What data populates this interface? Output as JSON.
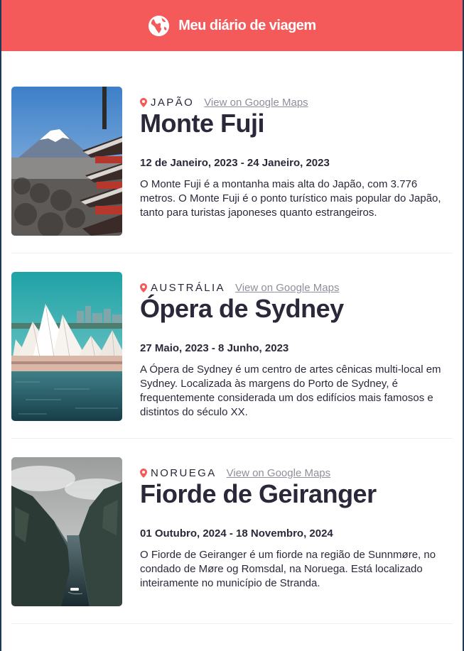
{
  "header": {
    "title": "Meu diário de viagem",
    "icon": "globe-icon"
  },
  "colors": {
    "accent": "#f55a5a",
    "text": "#2b283a",
    "muted": "#918e9b"
  },
  "entries": [
    {
      "country": "JAPÃO",
      "maps_label": "View on Google Maps",
      "title": "Monte Fuji",
      "dates": "12 de Janeiro, 2023 - 24 Janeiro, 2023",
      "description": "O Monte Fuji é a montanha mais alta do Japão, com 3.776 metros. O Monte Fuji é o ponto turístico mais popular do Japão, tanto para turistas japoneses quanto estrangeiros."
    },
    {
      "country": "AUSTRÁLIA",
      "maps_label": "View on Google Maps",
      "title": "Ópera de Sydney",
      "dates": "27 Maio, 2023 - 8 Junho, 2023",
      "description": "A Ópera de Sydney é um centro de artes cênicas multi-local em Sydney. Localizada às margens do Porto de Sydney, é frequentemente considerada um dos edifícios mais famosos e distintos do século XX."
    },
    {
      "country": "NORUEGA",
      "maps_label": "View on Google Maps",
      "title": "Fiorde de Geiranger",
      "dates": "01 Outubro, 2024 - 18 Novembro, 2024",
      "description": "O Fiorde de Geiranger é um fiorde na região de Sunnmøre, no condado de Møre og Romsdal, na Noruega. Está localizado inteiramente no município de Stranda."
    }
  ]
}
